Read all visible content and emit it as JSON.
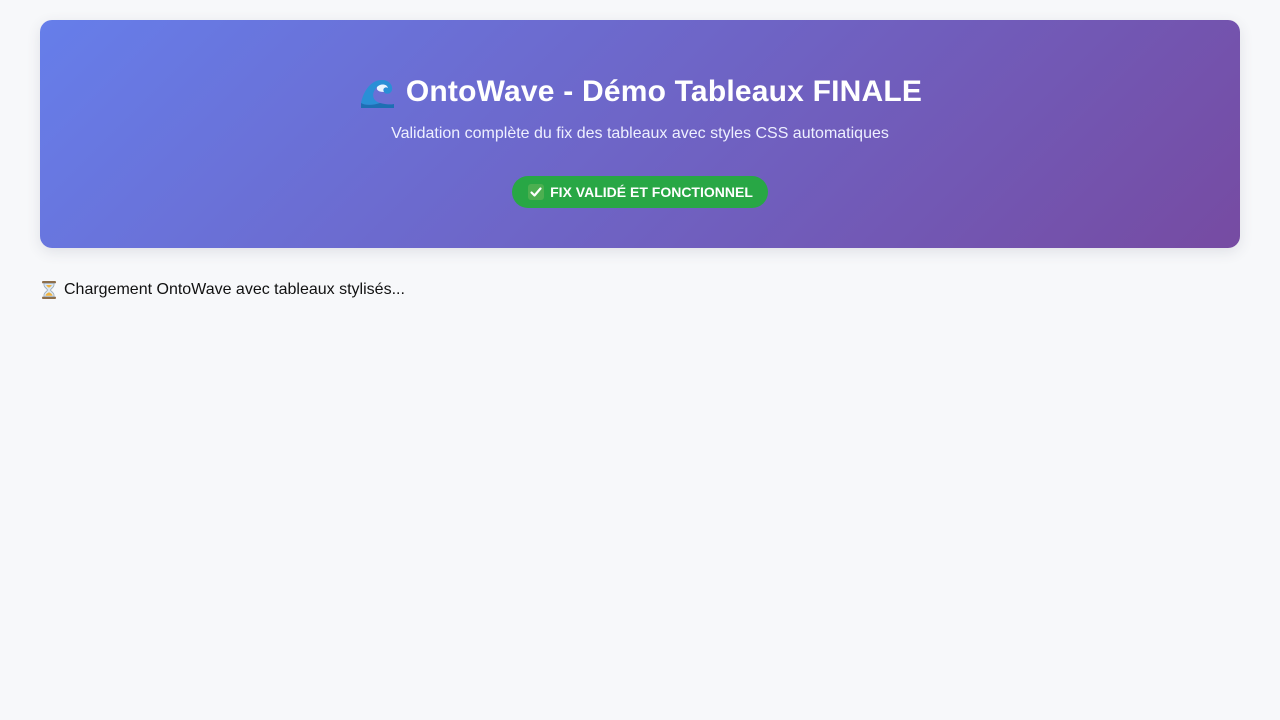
{
  "header": {
    "title": "OntoWave - Démo Tableaux FINALE",
    "title_icon": "wave-icon",
    "subtitle": "Validation complète du fix des tableaux avec styles CSS automatiques",
    "badge": {
      "icon": "check-icon",
      "label": "FIX VALIDÉ ET FONCTIONNEL",
      "color": "#28a745"
    },
    "gradient": [
      "#667eea",
      "#764ba2"
    ]
  },
  "status": {
    "icon": "hourglass-icon",
    "text": "Chargement OntoWave avec tableaux stylisés..."
  },
  "colors": {
    "background": "#f7f8fa",
    "badge_green": "#28a745"
  }
}
